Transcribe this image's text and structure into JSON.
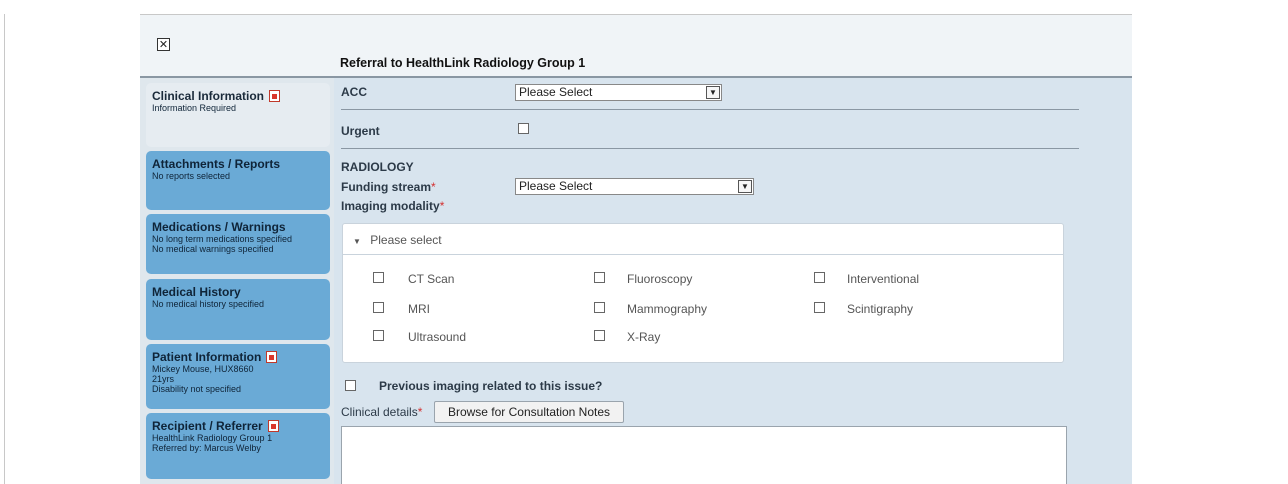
{
  "window": {
    "title": "Referral to HealthLink Radiology Group 1",
    "close_icon": "close-icon"
  },
  "sidebar": {
    "items": [
      {
        "label": "Clinical Information",
        "sub": [
          "Information Required"
        ],
        "has_pdf_icon": true
      },
      {
        "label": "Attachments / Reports",
        "sub": [
          "No reports selected"
        ],
        "has_pdf_icon": false
      },
      {
        "label": "Medications / Warnings",
        "sub": [
          "No long term medications specified",
          "No medical warnings specified"
        ],
        "has_pdf_icon": false
      },
      {
        "label": "Medical History",
        "sub": [
          "No medical history specified"
        ],
        "has_pdf_icon": false
      },
      {
        "label": "Patient Information",
        "sub": [
          "Mickey Mouse, HUX8660",
          "21yrs",
          "Disability not specified"
        ],
        "has_pdf_icon": true
      },
      {
        "label": "Recipient / Referrer",
        "sub": [
          "HealthLink Radiology Group 1",
          "Referred by: Marcus Welby"
        ],
        "has_pdf_icon": true
      }
    ]
  },
  "form": {
    "acc": {
      "label": "ACC",
      "value": "Please Select"
    },
    "urgent": {
      "label": "Urgent"
    },
    "section": "RADIOLOGY",
    "funding": {
      "label": "Funding stream",
      "req": "*",
      "value": "Please Select"
    },
    "imaging": {
      "label": "Imaging modality",
      "req": "*"
    },
    "modality_panel": {
      "header": "Please select",
      "options": [
        "CT Scan",
        "Fluoroscopy",
        "Interventional",
        "MRI",
        "Mammography",
        "Scintigraphy",
        "Ultrasound",
        "X-Ray"
      ]
    },
    "previous": {
      "label": "Previous imaging related to this issue?"
    },
    "clinical": {
      "label": "Clinical details",
      "req": "*",
      "button": "Browse for Consultation Notes"
    }
  },
  "colors": {
    "sidebar_active": "#6aaad6",
    "main_bg": "#d8e4ee",
    "required": "#d32f2f"
  }
}
